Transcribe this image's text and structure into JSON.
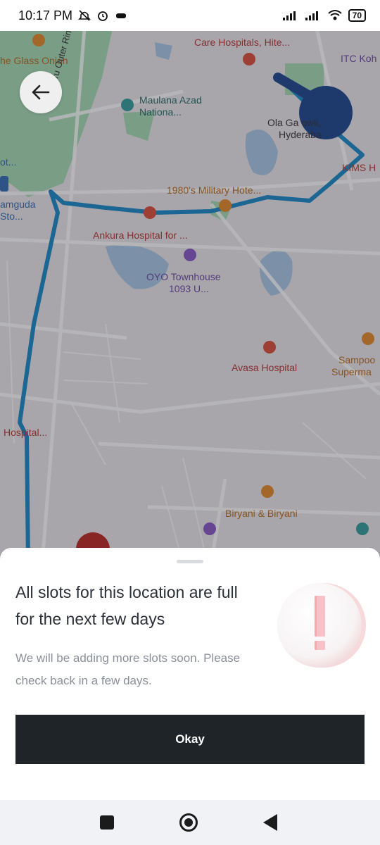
{
  "status_bar": {
    "time": "10:17 PM",
    "battery": "70",
    "icons": [
      "mute-icon",
      "alarm-icon",
      "game-icon",
      "signal-icon",
      "signal-icon",
      "wifi-icon",
      "battery-icon"
    ]
  },
  "map": {
    "labels": {
      "glass_onion": "he Glass Onion",
      "care_hospitals": "Care Hospitals, Hite...",
      "itc": "ITC Koh",
      "maulana_1": "Maulana Azad",
      "maulana_2": "Nationa...",
      "ola_1": "Ola Ga    owli,",
      "ola_2": "Hyderaba",
      "kims": "KIMS H",
      "ot": "ot...",
      "ring_road": "Nehru Outer Ring Road",
      "military": "1980's Military Hote...",
      "amguda_1": "amguda",
      "amguda_2": "Sto...",
      "ankura": "Ankura Hospital for ...",
      "oyo_1": "OYO Townhouse",
      "oyo_2": "1093 U...",
      "avasa": "Avasa Hospital",
      "sampo_1": "Sampoo",
      "sampo_2": "Superma",
      "hospital": "Hospital...",
      "biryani": "Biryani & Biryani"
    }
  },
  "sheet": {
    "title": "All slots for this location are full for the next few days",
    "subtitle": "We will be adding more slots soon. Please check back in a few days.",
    "button_label": "Okay"
  },
  "colors": {
    "route": "#1f8ac7",
    "button_bg": "#1f2428",
    "title_text": "#2c3038",
    "subtitle_text": "#8a8f98"
  }
}
